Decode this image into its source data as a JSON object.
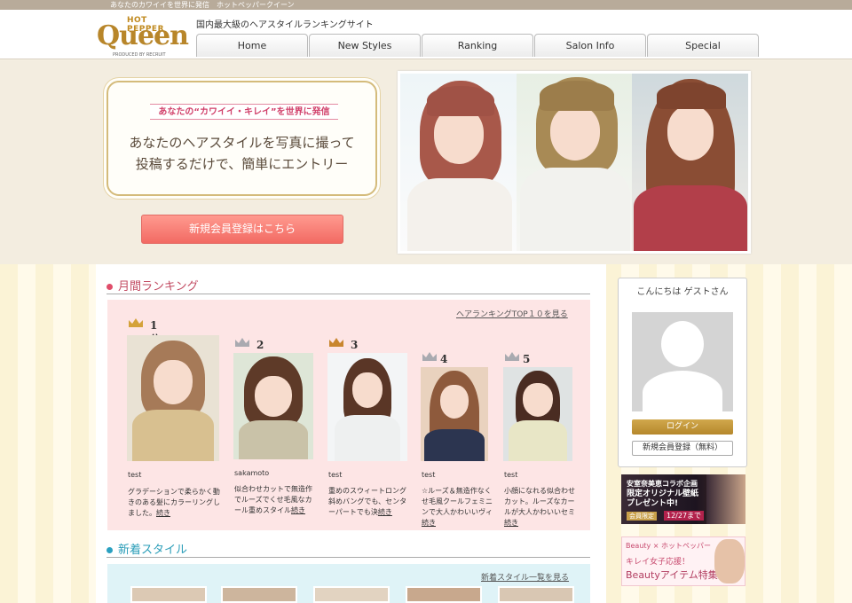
{
  "top_strip": "あなたのカワイイを世界に発信　ホットペッパークイーン",
  "logo": {
    "small": "HOT PEPPER",
    "main": "Queen",
    "by": "PRODUCED BY RECRUIT"
  },
  "tagline": "国内最大級のヘアスタイルランキングサイト",
  "nav": [
    "Home",
    "New Styles",
    "Ranking",
    "Salon Info",
    "Special"
  ],
  "hero": {
    "ribbon": "あなたの“カワイイ・キレイ”を世界に発信",
    "line1": "あなたのヘアスタイルを写真に撮って",
    "line2": "投稿するだけで、簡単にエントリー",
    "register_button": "新規会員登録はこちら"
  },
  "monthly": {
    "title": "月間ランキング",
    "more_link": "ヘアランキングTOP１０を見る",
    "items": [
      {
        "rank": "1位",
        "user": "test",
        "desc": "グラデーションで柔らかく動きのある髪にカラーリングしました。",
        "more": "続き"
      },
      {
        "rank": "2位",
        "user": "sakamoto",
        "desc": "似合わせカットで無造作でルーズでくせ毛風なカール重めスタイル",
        "more": "続き"
      },
      {
        "rank": "3位",
        "user": "test",
        "desc": "重めのスウィートロング斜めバングでも、センターパートでも決",
        "more": "続き"
      },
      {
        "rank": "4位",
        "user": "test",
        "desc": "☆ルーズ＆無造作なくせ毛風クールフェミニンで大人かわいいヴィ",
        "more": "続き"
      },
      {
        "rank": "5位",
        "user": "test",
        "desc": "小顔になれる似合わせカット。ルーズなカールが大人かわいいセミ",
        "more": "続き"
      }
    ]
  },
  "new_styles": {
    "title": "新着スタイル",
    "more_link": "新着スタイル一覧を見る"
  },
  "sidebar": {
    "greeting": "こんにちは ゲストさん",
    "login": "ログイン",
    "register": "新規会員登録（無料）"
  },
  "banner1": {
    "line1": "安室奈美恵コラボ企画",
    "line2a": "限定オリジナル壁紙",
    "line2b": "プレゼント中!",
    "tag": "会員限定",
    "date": "12/27まで"
  },
  "banner2": {
    "line1": "Beauty × ホットペッパー",
    "line2": "キレイ女子応援！",
    "line3": "Beautyアイテム特集"
  }
}
